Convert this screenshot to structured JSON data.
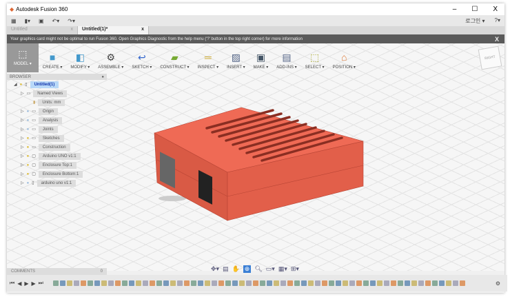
{
  "window": {
    "title": "Autodesk Fusion 360",
    "min": "–",
    "max": "☐",
    "close": "X"
  },
  "qat": {
    "grid": "▦",
    "file": "▮▾",
    "save": "▣",
    "undo": "↶▾",
    "redo": "↷▾",
    "user": "로그인 ▾",
    "help": "?▾"
  },
  "tabs": [
    {
      "label": "Untitled",
      "close": "x"
    },
    {
      "label": "Untitled(1)*",
      "close": "x"
    }
  ],
  "warning": {
    "text": "Your graphics card might not be optimal to run Fusion 360. Open Graphics Diagnostic from the help menu ('?' button in the top right corner) for more information",
    "close": "X"
  },
  "toolbar": [
    "MODEL ▾",
    "CREATE ▾",
    "MODIFY ▾",
    "ASSEMBLE ▾",
    "SKETCH ▾",
    "CONSTRUCT ▾",
    "INSPECT ▾",
    "INSERT ▾",
    "MAKE ▾",
    "ADD-INS ▾",
    "SELECT ▾",
    "POSITION ▾"
  ],
  "viewcube": "RIGHT",
  "browser": {
    "title": "BROWSER",
    "nodes": [
      "Untitled(1)",
      "Named Views",
      "Units: mm",
      "Origin",
      "Analysis",
      "Joints",
      "Sketches",
      "Construction",
      "Arduino UNO v1:1",
      "Enclosure Top:1",
      "Enclosure Bottom:1",
      "arduino uno v1:1"
    ]
  },
  "comments": {
    "title": "COMMENTS",
    "count": "0"
  },
  "colors": {
    "body": "#e8604a",
    "accent": "#3a7fd5"
  }
}
